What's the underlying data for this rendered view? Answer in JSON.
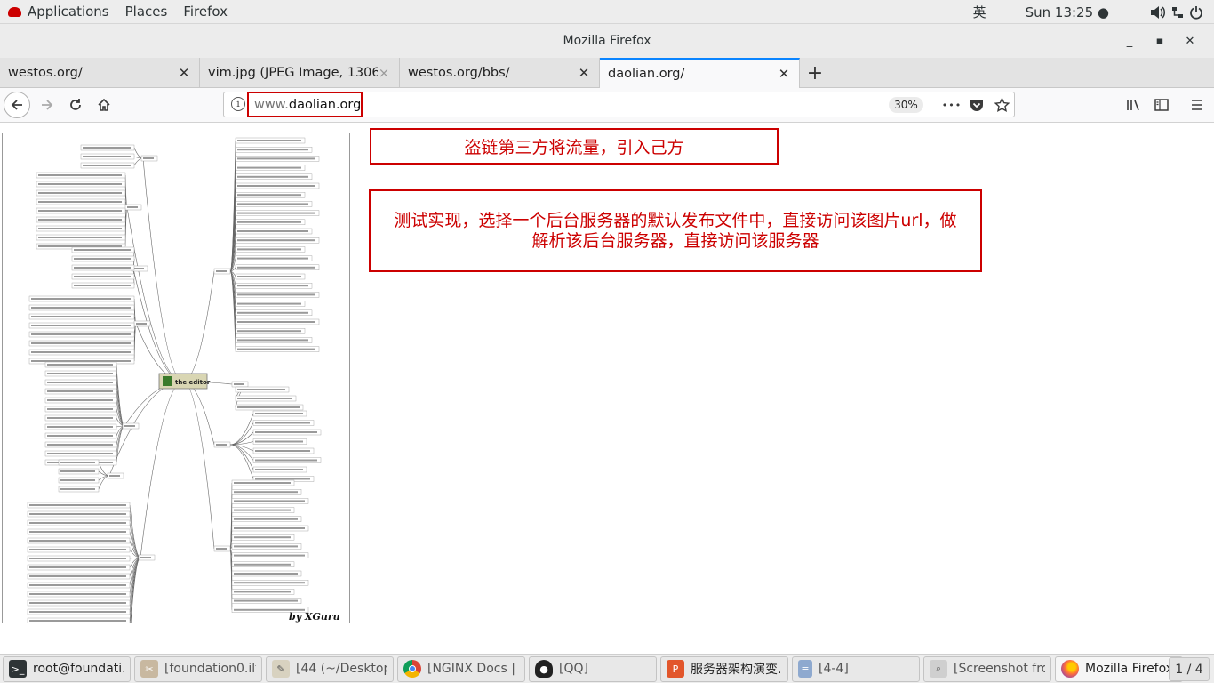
{
  "topbar": {
    "applications": "Applications",
    "places": "Places",
    "firefox": "Firefox",
    "input_method": "英",
    "clock": "Sun 13:25 ●"
  },
  "window": {
    "title": "Mozilla Firefox",
    "minimize": "_",
    "maximize": "▪",
    "close": "✕"
  },
  "tabs": [
    {
      "label": "westos.org/",
      "close": "✕"
    },
    {
      "label": "vim.jpg (JPEG Image, 1306",
      "close": "×"
    },
    {
      "label": "westos.org/bbs/",
      "close": "✕"
    },
    {
      "label": "daolian.org/",
      "close": "✕",
      "active": true
    }
  ],
  "newtab": "+",
  "nav": {
    "url_prefix": "www.",
    "url_domain": "daolian.org",
    "zoom": "30%",
    "more": "•••"
  },
  "content": {
    "mindmap_center": "the editor",
    "mindmap_signature": "by XGuru",
    "annotation1": "盗链第三方将流量，引入己方",
    "annotation2": "测试实现，选择一个后台服务器的默认发布文件中，直接访问该图片url，做解析该后台服务器，直接访问该服务器"
  },
  "colors": {
    "accent": "#0a84ff",
    "annotation_red": "#cc0000"
  },
  "taskbar": {
    "items": [
      {
        "label": "root@foundati...",
        "icon": "terminal-icon"
      },
      {
        "label": "[foundation0.ilt....",
        "icon": "screenshot-icon"
      },
      {
        "label": "[44 (~/Desktop...",
        "icon": "text-editor-icon"
      },
      {
        "label": "[NGINX Docs | ...",
        "icon": "chrome-icon"
      },
      {
        "label": "[QQ]",
        "icon": "qq-icon"
      },
      {
        "label": "服务器架构演变...",
        "icon": "wps-icon"
      },
      {
        "label": "[4-4]",
        "icon": "document-icon"
      },
      {
        "label": "[Screenshot fro...",
        "icon": "image-viewer-icon"
      },
      {
        "label": "Mozilla Firefox",
        "icon": "firefox-icon"
      }
    ],
    "workspace": "1 / 4"
  }
}
